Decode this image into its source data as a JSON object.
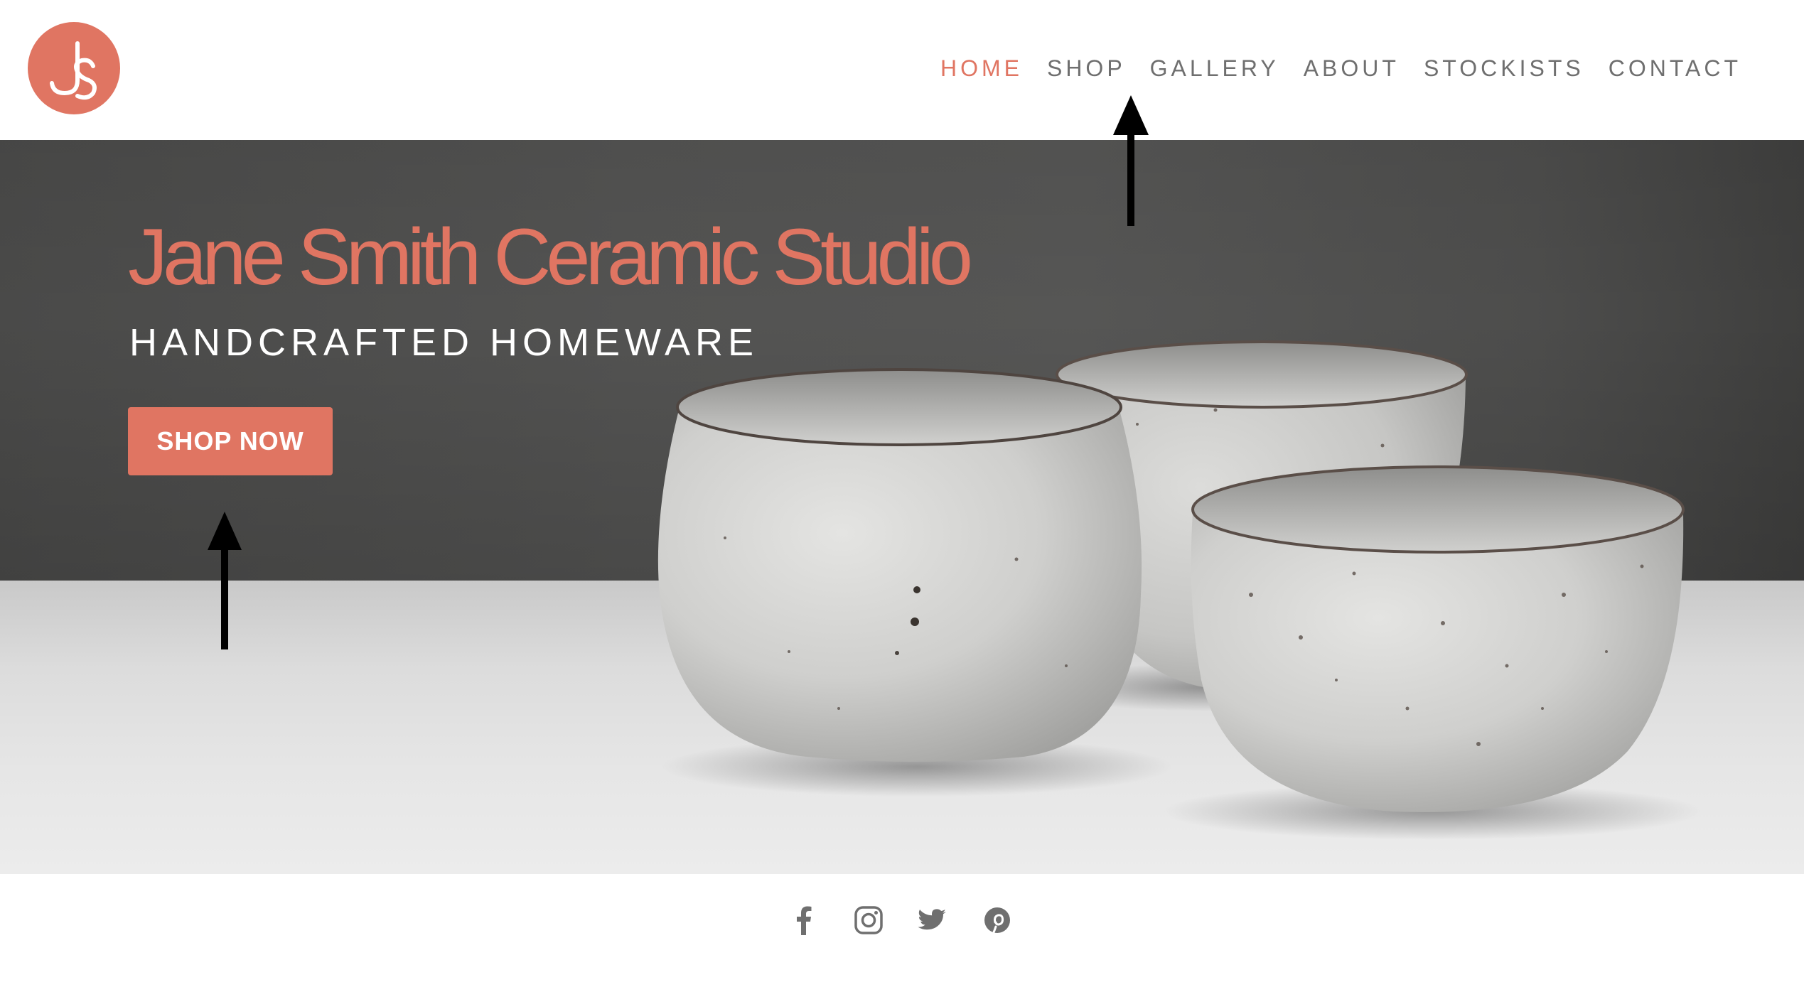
{
  "brand": {
    "logo_text": "JS",
    "accent_color": "#e07562"
  },
  "nav": {
    "items": [
      {
        "label": "HOME",
        "active": true
      },
      {
        "label": "SHOP",
        "active": false
      },
      {
        "label": "GALLERY",
        "active": false
      },
      {
        "label": "ABOUT",
        "active": false
      },
      {
        "label": "STOCKISTS",
        "active": false
      },
      {
        "label": "CONTACT",
        "active": false
      }
    ]
  },
  "hero": {
    "title": "Jane Smith Ceramic Studio",
    "subtitle": "HANDCRAFTED HOMEWARE",
    "cta_label": "SHOP NOW",
    "image_subject": "three speckled white ceramic bowls"
  },
  "annotations": {
    "arrows": [
      {
        "points_to": "SHOP nav link",
        "direction": "up"
      },
      {
        "points_to": "SHOP NOW button",
        "direction": "up"
      }
    ]
  },
  "social": {
    "icons": [
      "facebook-icon",
      "instagram-icon",
      "twitter-icon",
      "pinterest-icon"
    ],
    "icon_color": "#6f6f6f"
  }
}
